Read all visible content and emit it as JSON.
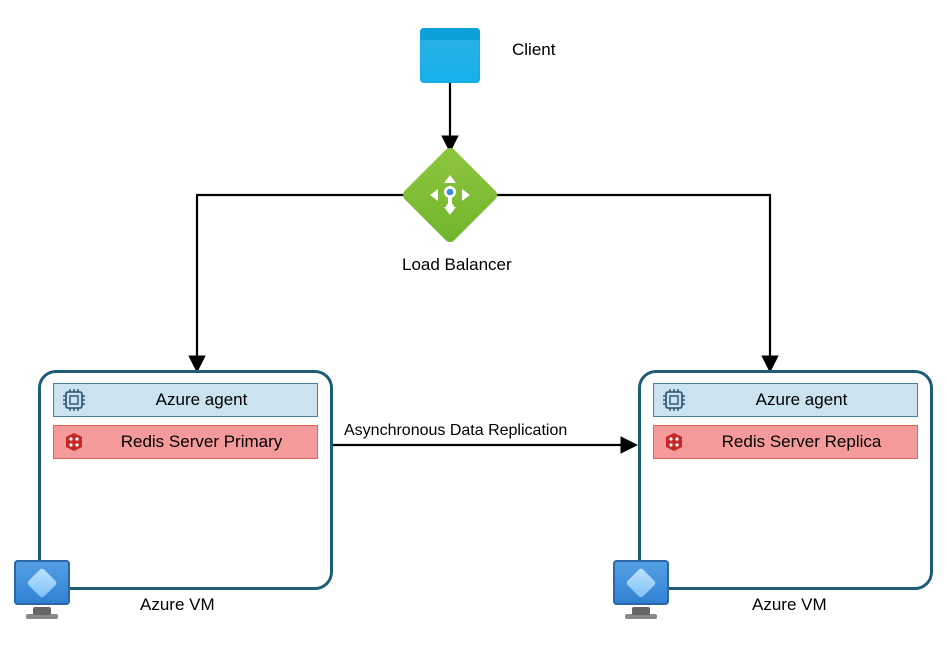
{
  "client": {
    "label": "Client"
  },
  "loadBalancer": {
    "label": "Load Balancer"
  },
  "replication": {
    "label": "Asynchronous Data Replication"
  },
  "vmLeft": {
    "agent": "Azure agent",
    "redis": "Redis Server Primary",
    "vmLabel": "Azure VM"
  },
  "vmRight": {
    "agent": "Azure agent",
    "redis": "Redis Server Replica",
    "vmLabel": "Azure VM"
  }
}
